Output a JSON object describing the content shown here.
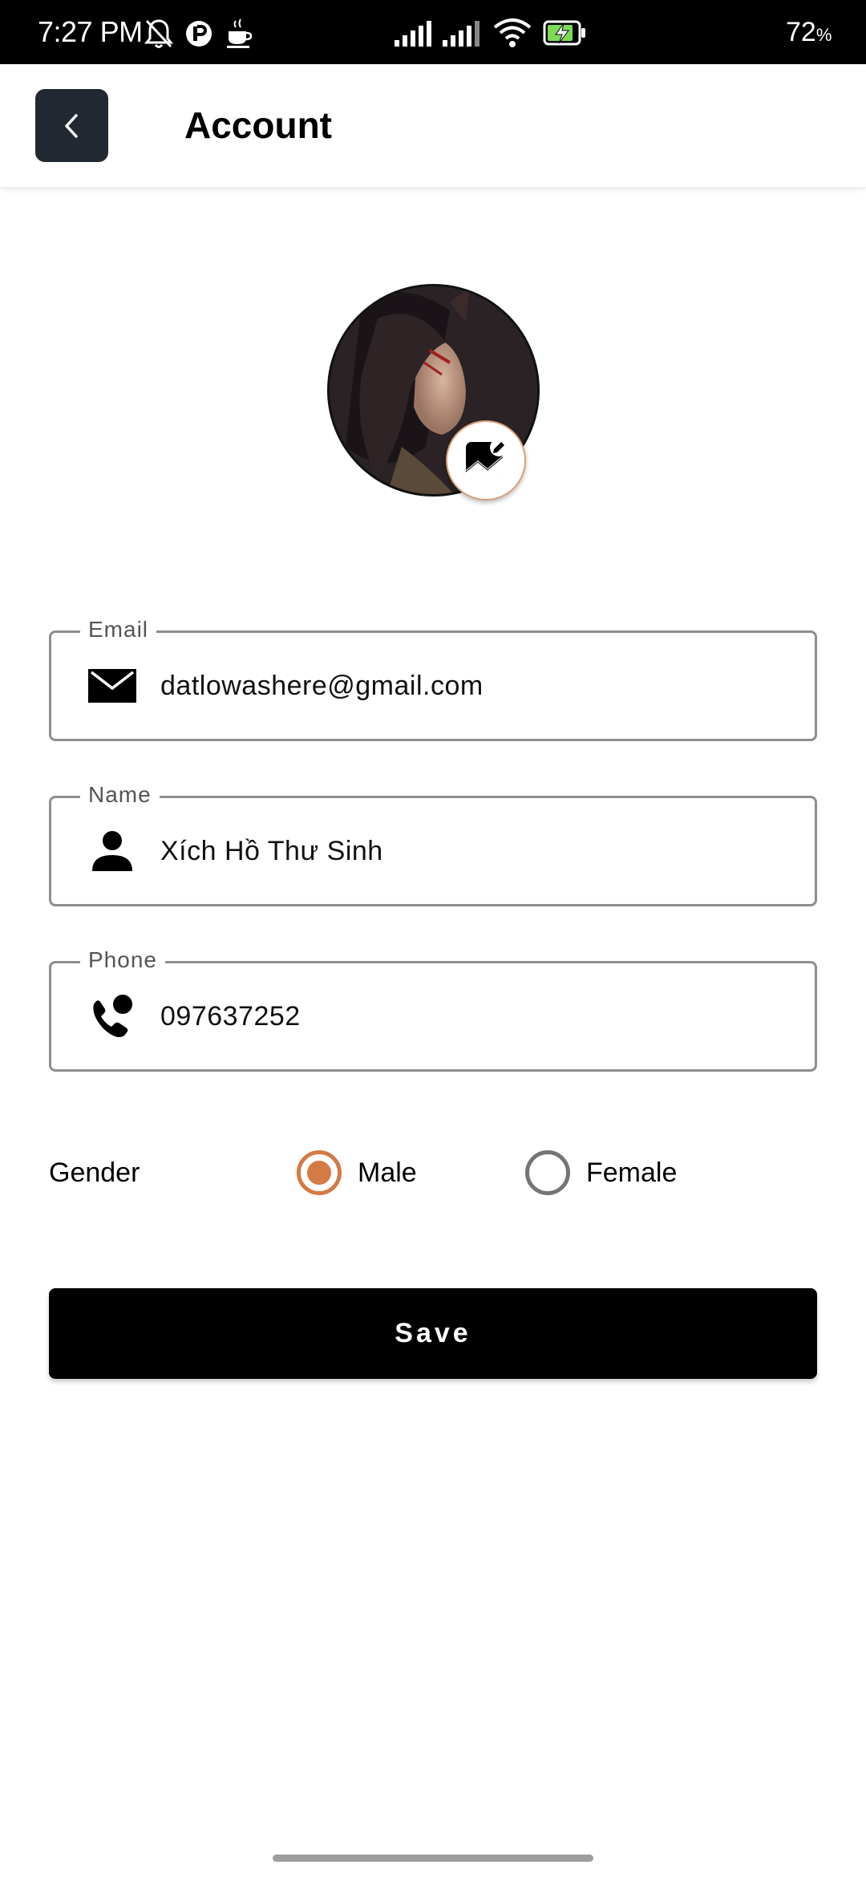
{
  "status_bar": {
    "time": "7:27 PM",
    "battery_percent": "72",
    "battery_unit": "%",
    "battery_level": 0.72,
    "left_icons": [
      "bell-off-icon",
      "circle-p-icon",
      "coffee-icon"
    ],
    "right_icons": [
      "signal-icon",
      "signal-icon",
      "wifi-icon",
      "battery-charging-icon"
    ]
  },
  "app_bar": {
    "title": "Account",
    "back_icon": "chevron-left-icon"
  },
  "avatar": {
    "edit_icon": "image-edit-icon",
    "border_color": "#d8a07a"
  },
  "form": {
    "email": {
      "label": "Email",
      "value": "datlowashere@gmail.com",
      "icon": "mail-icon"
    },
    "name": {
      "label": "Name",
      "value": "Xích Hồ Thư Sinh",
      "icon": "person-icon"
    },
    "phone": {
      "label": "Phone",
      "value": "097637252",
      "icon": "phone-call-icon"
    }
  },
  "gender": {
    "label": "Gender",
    "options": [
      {
        "label": "Male",
        "selected": true
      },
      {
        "label": "Female",
        "selected": false
      }
    ],
    "accent_color": "#d37a45"
  },
  "save_label": "Save"
}
